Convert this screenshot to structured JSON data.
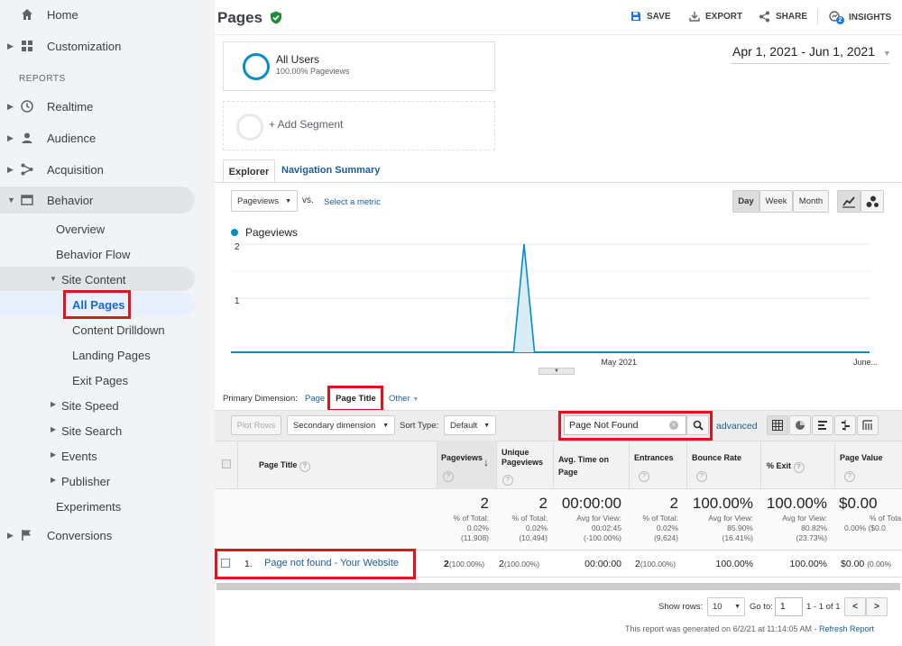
{
  "sidebar": {
    "home": "Home",
    "customization": "Customization",
    "reports_header": "REPORTS",
    "realtime": "Realtime",
    "audience": "Audience",
    "acquisition": "Acquisition",
    "behavior": "Behavior",
    "overview": "Overview",
    "behavior_flow": "Behavior Flow",
    "site_content": "Site Content",
    "all_pages": "All Pages",
    "content_drilldown": "Content Drilldown",
    "landing_pages": "Landing Pages",
    "exit_pages": "Exit Pages",
    "site_speed": "Site Speed",
    "site_search": "Site Search",
    "events": "Events",
    "publisher": "Publisher",
    "experiments": "Experiments",
    "conversions": "Conversions"
  },
  "header": {
    "title": "Pages",
    "save": "SAVE",
    "export": "EXPORT",
    "share": "SHARE",
    "insights": "INSIGHTS",
    "insights_badge": "2",
    "date_range": "Apr 1, 2021 - Jun 1, 2021"
  },
  "segments": {
    "all_users": "All Users",
    "all_users_sub": "100.00% Pageviews",
    "add_segment": "+ Add Segment"
  },
  "tabs": {
    "explorer": "Explorer",
    "nav_summary": "Navigation Summary"
  },
  "chart_controls": {
    "metric": "Pageviews",
    "vs": "vs.",
    "select_metric": "Select a metric",
    "day": "Day",
    "week": "Week",
    "month": "Month"
  },
  "chart_data": {
    "type": "area",
    "series": [
      {
        "name": "Pageviews",
        "color": "#058dc7"
      }
    ],
    "y_ticks": [
      "2",
      "1"
    ],
    "ylim": [
      0,
      2
    ],
    "x_labels": [
      "May 2021",
      "June..."
    ],
    "xlim": [
      "2021-04-01",
      "2021-06-01"
    ],
    "points": [
      {
        "x": "2021-04-01",
        "y": 0
      },
      {
        "x": "2021-04-28",
        "y": 0
      },
      {
        "x": "2021-04-29",
        "y": 2
      },
      {
        "x": "2021-04-30",
        "y": 0
      },
      {
        "x": "2021-06-01",
        "y": 0
      }
    ]
  },
  "dimension": {
    "label": "Primary Dimension:",
    "page": "Page",
    "page_title": "Page Title",
    "other": "Other"
  },
  "toolbar": {
    "plot_rows": "Plot Rows",
    "secondary": "Secondary dimension",
    "sort_type_label": "Sort Type:",
    "sort_default": "Default",
    "search_value": "Page Not Found",
    "advanced": "advanced"
  },
  "table": {
    "headers": {
      "page_title": "Page Title",
      "pageviews": "Pageviews",
      "unique": "Unique Pageviews",
      "avg_time": "Avg. Time on Page",
      "entrances": "Entrances",
      "bounce": "Bounce Rate",
      "exit": "% Exit",
      "value": "Page Value"
    },
    "totals": {
      "pageviews": "2",
      "pageviews_sub1": "% of Total:",
      "pageviews_sub2": "0.02%",
      "pageviews_sub3": "(11,908)",
      "unique": "2",
      "unique_sub1": "% of Total:",
      "unique_sub2": "0.02%",
      "unique_sub3": "(10,494)",
      "avg_time": "00:00:00",
      "avg_time_sub1": "Avg for View:",
      "avg_time_sub2": "00:02:45",
      "avg_time_sub3": "(-100.00%)",
      "entrances": "2",
      "entrances_sub1": "% of Total:",
      "entrances_sub2": "0.02%",
      "entrances_sub3": "(9,624)",
      "bounce": "100.00%",
      "bounce_sub1": "Avg for View:",
      "bounce_sub2": "85.90%",
      "bounce_sub3": "(16.41%)",
      "exit": "100.00%",
      "exit_sub1": "Avg for View:",
      "exit_sub2": "80.82%",
      "exit_sub3": "(23.73%)",
      "value": "$0.00",
      "value_sub1": "% of Tota",
      "value_sub2": "0.00% ($0.0"
    },
    "row": {
      "index": "1.",
      "title": "Page not found - Your Website",
      "pageviews": "2",
      "pageviews_pct": "(100.00%)",
      "unique": "2",
      "unique_pct": "(100.00%)",
      "avg_time": "00:00:00",
      "entrances": "2",
      "entrances_pct": "(100.00%)",
      "bounce": "100.00%",
      "exit": "100.00%",
      "value": "$0.00",
      "value_pct": "(0.00%"
    }
  },
  "pagination": {
    "show_rows": "Show rows:",
    "rows": "10",
    "goto": "Go to:",
    "page": "1",
    "range": "1 - 1 of 1"
  },
  "footer": {
    "generated": "This report was generated on 6/2/21 at 11:14:05 AM -",
    "refresh": "Refresh Report"
  }
}
